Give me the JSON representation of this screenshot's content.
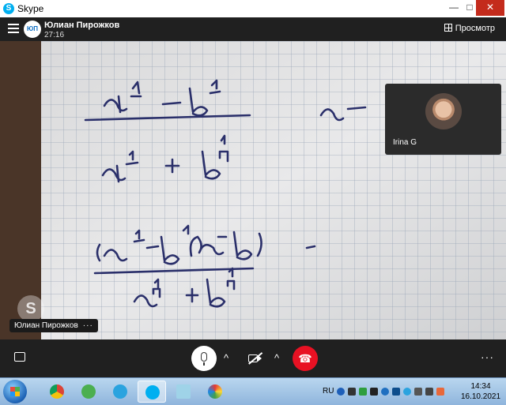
{
  "window": {
    "title": "Skype",
    "app_icon": "skype-icon"
  },
  "call_header": {
    "caller_initials": "ЮП",
    "caller_name": "Юлиан Пирожков",
    "timer": "27:16",
    "view_label": "Просмотр"
  },
  "video": {
    "self_view_name": "Irina G",
    "remote_name": "Юлиан Пирожков",
    "more_label": "···"
  },
  "controls": {
    "chevron": "^",
    "end_call": "☎",
    "more": "···"
  },
  "taskbar": {
    "apps": [
      "chrome-icon",
      "utorrent-icon",
      "telegram-icon",
      "skype-icon",
      "notepad-icon",
      "paint-icon"
    ],
    "language": "RU",
    "time": "14:34",
    "date": "16.10.2021"
  },
  "colors": {
    "end_call": "#e81123",
    "accent": "#00aff0",
    "header": "#202020"
  }
}
